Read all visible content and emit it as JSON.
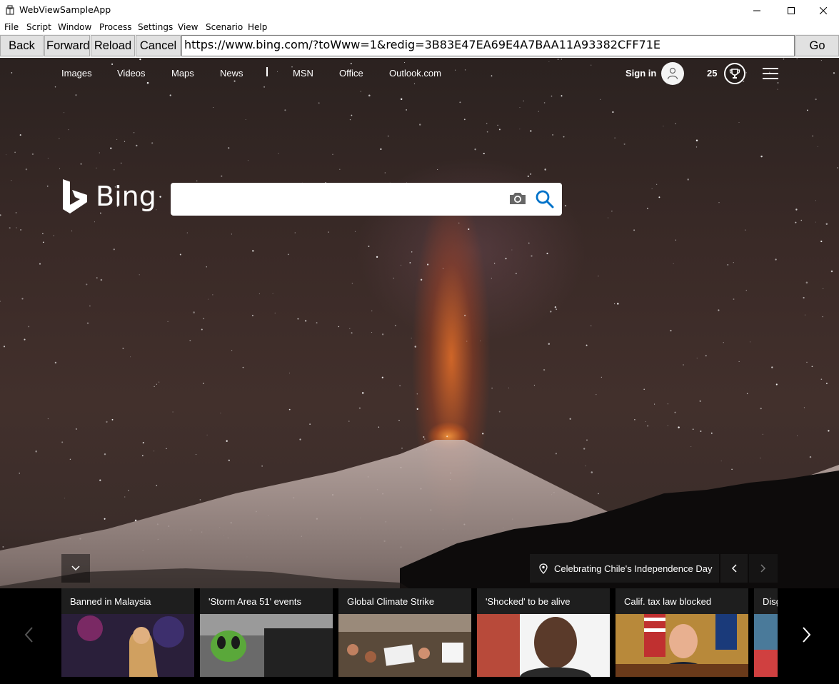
{
  "window": {
    "title": "WebViewSampleApp",
    "controls": [
      "minimize",
      "maximize",
      "close"
    ]
  },
  "menu": [
    "File",
    "Script",
    "Window",
    "Process",
    "Settings",
    "View",
    "Scenario",
    "Help"
  ],
  "toolbar": {
    "back_label": "Back",
    "forward_label": "Forward",
    "reload_label": "Reload",
    "cancel_label": "Cancel",
    "address": "https://www.bing.com/?toWww=1&redig=3B83E47EA69E4A7BAA11A93382CFF71E",
    "go_label": "Go"
  },
  "bing": {
    "nav": [
      "Images",
      "Videos",
      "Maps",
      "News",
      "MSN",
      "Office",
      "Outlook.com"
    ],
    "signin_label": "Sign in",
    "reward_points": "25",
    "logo_text": "Bing",
    "search": {
      "value": "",
      "placeholder": ""
    },
    "location_caption": "Celebrating Chile's Independence Day",
    "news": [
      {
        "title": "Banned in Malaysia",
        "color": "#3a2a4a"
      },
      {
        "title": "'Storm Area 51' events",
        "color": "#3c3c3c"
      },
      {
        "title": "Global Climate Strike",
        "color": "#6a5a4a"
      },
      {
        "title": "'Shocked' to be alive",
        "color": "#c04a3a"
      },
      {
        "title": "Calif. tax law blocked",
        "color": "#b8893a"
      },
      {
        "title": "Disg",
        "color": "#4a7a9a"
      }
    ]
  },
  "icons": {
    "camera": "camera-icon",
    "search": "search-icon",
    "user": "user-icon",
    "rewards": "trophy-icon",
    "menu": "hamburger-icon",
    "location": "location-pin-icon"
  },
  "colors": {
    "search_blue": "#0072c9",
    "toolbar_bg": "#f0f0f0",
    "button_bg": "#e1e1e1"
  }
}
